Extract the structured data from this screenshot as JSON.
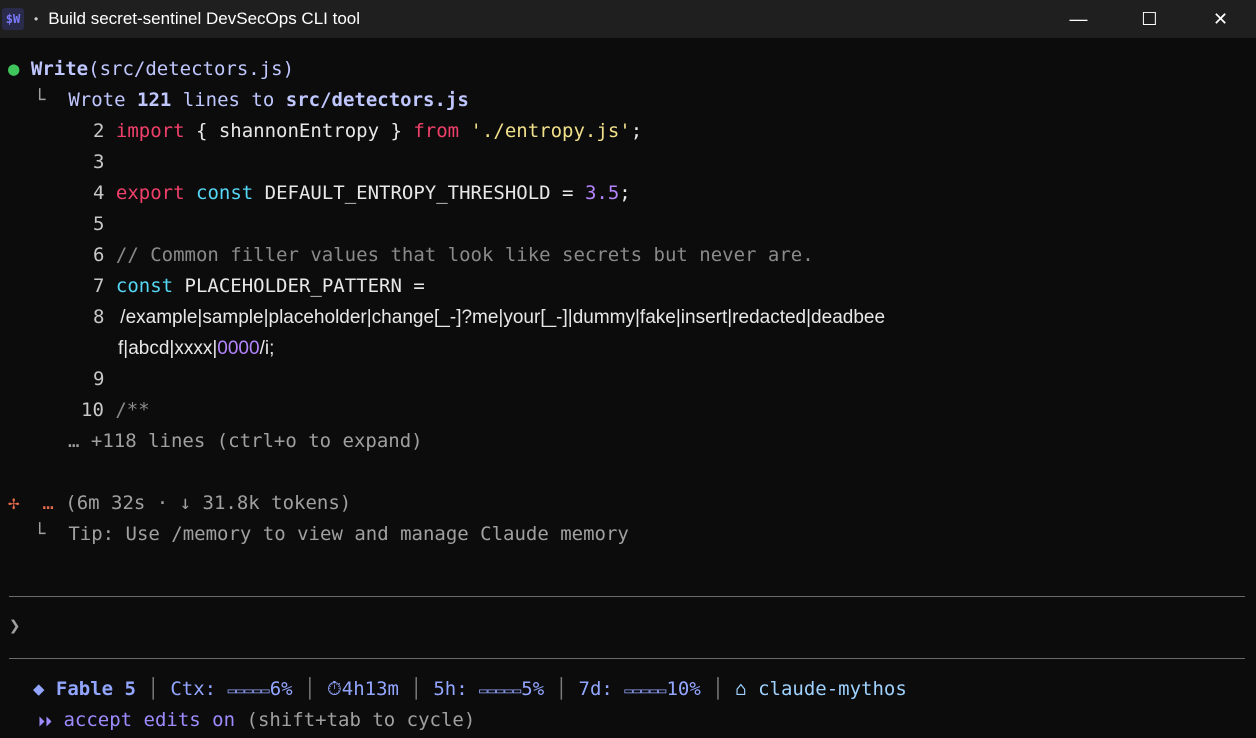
{
  "window": {
    "icon_label": "$W",
    "title": "Build secret-sentinel DevSecOps CLI tool",
    "minimize": "—",
    "maximize": "☐",
    "close": "✕"
  },
  "tool_call": {
    "bullet": "●",
    "name": "Write",
    "open_paren": "(",
    "arg": "src/detectors.js",
    "close_paren": ")",
    "result_branch": "└",
    "result_prefix": "Wrote",
    "result_count": "121",
    "result_mid": "lines to",
    "result_path": "src/detectors.js"
  },
  "code": {
    "line2": {
      "num": "2",
      "t1": "import",
      "t2": " { shannonEntropy } ",
      "t3": "from",
      "t4": " ",
      "t5": "'./entropy.js'",
      "t6": ";"
    },
    "line3": {
      "num": "3"
    },
    "line4": {
      "num": "4",
      "t1": "export",
      "t2": " ",
      "t3": "const",
      "t4": " DEFAULT_ENTROPY_THRESHOLD = ",
      "t5": "3.5",
      "t6": ";"
    },
    "line5": {
      "num": "5"
    },
    "line6": {
      "num": "6",
      "t1": "// Common filler values that look like secrets but never are."
    },
    "line7": {
      "num": "7",
      "t1": "const",
      "t2": " PLACEHOLDER_PATTERN ="
    },
    "line8": {
      "num": "8",
      "t1": "  /example|sample|placeholder|change[_-]?me|your[_-]|dummy|fake|insert|redacted|deadbee"
    },
    "line8b": {
      "t1": "f|abcd|xxxx|",
      "t2": "0000",
      "t3": "/i;"
    },
    "line9": {
      "num": "9"
    },
    "line10": {
      "num": "10",
      "t1": "/**"
    },
    "more": "… +118 lines (ctrl+o to expand)"
  },
  "progress": {
    "spinner": "✢",
    "ellipsis": "…",
    "detail": "(6m 32s · ↓ 31.8k tokens)",
    "tip_branch": "└",
    "tip": "Tip: Use /memory to view and manage Claude memory"
  },
  "prompt": {
    "symbol": "❯"
  },
  "statusbar": {
    "model_icon": "◆",
    "model": "Fable 5",
    "ctx_label": "Ctx:",
    "ctx_bar": "▭▭▭▭▭",
    "ctx_pct": "6%",
    "timer_icon": "⏱",
    "timer": "4h13m",
    "h5_label": "5h:",
    "h5_bar": "▭▭▭▭▭",
    "h5_pct": "5%",
    "d7_label": "7d:",
    "d7_bar": "▭▭▭▭▭",
    "d7_pct": "10%",
    "home_icon": "⌂",
    "project": "claude-mythos",
    "separator": "│"
  },
  "mode": {
    "icon": "⏵⏵",
    "label": "accept edits on",
    "hint": "(shift+tab to cycle)"
  }
}
